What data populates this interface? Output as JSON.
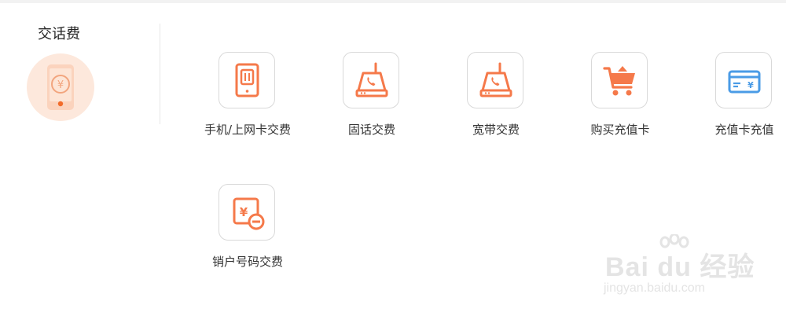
{
  "section": {
    "title": "交话费",
    "icon": "phone-yuan-icon"
  },
  "services": [
    {
      "label": "手机/上网卡交费",
      "icon": "mobile-sim-icon"
    },
    {
      "label": "固话交费",
      "icon": "landline-phone-icon"
    },
    {
      "label": "宽带交费",
      "icon": "broadband-router-icon"
    },
    {
      "label": "购买充值卡",
      "icon": "shopping-cart-icon"
    },
    {
      "label": "充值卡充值",
      "icon": "recharge-card-icon"
    },
    {
      "label": "销户号码交费",
      "icon": "cancel-account-icon"
    }
  ],
  "watermark": {
    "brand": "Bai du 经验",
    "url": "jingyan.baidu.com"
  },
  "colors": {
    "accent_orange": "#f5794a",
    "accent_blue": "#4a9be6",
    "circle_bg": "#fde8dc",
    "tile_border": "#d9d9d9"
  }
}
